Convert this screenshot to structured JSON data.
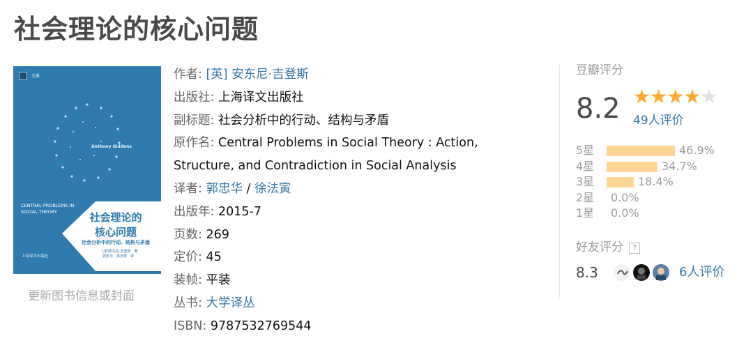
{
  "page": {
    "title": "社会理论的核心问题"
  },
  "cover": {
    "series_label": "文景",
    "author_en": "Anthony Giddens",
    "title_en_line1": "CENTRAL PROBLEMS IN",
    "title_en_line2": "SOCIAL THEORY",
    "title_cn_line1": "社会理论的",
    "title_cn_line2": "核心问题",
    "subtitle_cn": "社会分析中的行动、结构与矛盾",
    "credit_line1": "[英]安东尼·吉登斯　著",
    "credit_line2": "郭忠华　徐法寅　译",
    "publisher": "上海译文出版社",
    "update_link": "更新图书信息或封面"
  },
  "info": {
    "author_label": "作者: ",
    "author_value": "[英] 安东尼·吉登斯",
    "publisher_label": "出版社: ",
    "publisher_value": "上海译文出版社",
    "subtitle_label": "副标题: ",
    "subtitle_value": "社会分析中的行动、结构与矛盾",
    "original_label": "原作名: ",
    "original_value_line1": "Central Problems in Social Theory : Action,",
    "original_value_line2": "Structure, and Contradiction in Social Analysis",
    "translator_label": "译者: ",
    "translator_1": "郭忠华",
    "translator_sep": " / ",
    "translator_2": "徐法寅",
    "year_label": "出版年: ",
    "year_value": "2015-7",
    "pages_label": "页数: ",
    "pages_value": "269",
    "price_label": "定价: ",
    "price_value": "45",
    "binding_label": "装帧: ",
    "binding_value": "平装",
    "series_label": "丛书: ",
    "series_value": "大学译丛",
    "isbn_label": "ISBN: ",
    "isbn_value": "9787532769544"
  },
  "rating": {
    "title": "豆瓣评分",
    "score": "8.2",
    "stars_filled": 4,
    "stars_total": 5,
    "votes": "49人评价",
    "distribution": [
      {
        "label": "5星",
        "percent": 46.9,
        "text": "46.9%"
      },
      {
        "label": "4星",
        "percent": 34.7,
        "text": "34.7%"
      },
      {
        "label": "3星",
        "percent": 18.4,
        "text": "18.4%"
      },
      {
        "label": "2星",
        "percent": 0.0,
        "text": "0.0%"
      },
      {
        "label": "1星",
        "percent": 0.0,
        "text": "0.0%"
      }
    ],
    "friends_title": "好友评分",
    "friends_help": "?",
    "friends_score": "8.3",
    "friends_votes": "6人评价"
  },
  "colors": {
    "link": "#3377aa",
    "star": "#ffac2d",
    "bar": "#ffd596",
    "cover": "#2f7bb0"
  }
}
